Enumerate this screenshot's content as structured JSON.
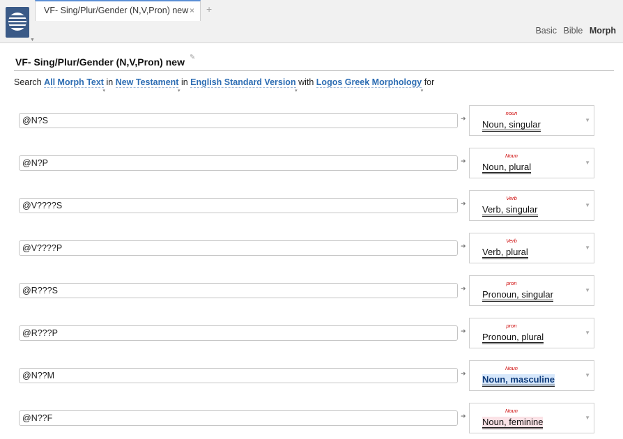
{
  "tab": {
    "title": "VF- Sing/Plur/Gender (N,V,Pron) new",
    "close": "×",
    "add": "+"
  },
  "modes": [
    {
      "label": "Basic",
      "active": false
    },
    {
      "label": "Bible",
      "active": false
    },
    {
      "label": "Morph",
      "active": true
    }
  ],
  "document": {
    "title": "VF- Sing/Plur/Gender (N,V,Pron) new"
  },
  "search": {
    "prefix": "Search",
    "scope": "All Morph Text",
    "in1": "in",
    "range": "New Testament",
    "in2": "in",
    "version": "English Standard Version",
    "with": "with",
    "morphology": "Logos Greek Morphology",
    "suffix": "for"
  },
  "rows": [
    {
      "query": "@N?S",
      "tag": "noun",
      "label": "Noun, singular",
      "highlight": ""
    },
    {
      "query": "@N?P",
      "tag": "Noun",
      "label": "Noun, plural",
      "highlight": ""
    },
    {
      "query": "@V????S",
      "tag": "Verb",
      "label": "Verb, singular",
      "highlight": ""
    },
    {
      "query": "@V????P",
      "tag": "Verb",
      "label": "Verb, plural",
      "highlight": ""
    },
    {
      "query": "@R???S",
      "tag": "pron",
      "label": "Pronoun, singular",
      "highlight": ""
    },
    {
      "query": "@R???P",
      "tag": "pron",
      "label": "Pronoun, plural",
      "highlight": ""
    },
    {
      "query": "@N??M",
      "tag": "Noun",
      "label": "Noun, masculine",
      "highlight": "blue"
    },
    {
      "query": "@N??F",
      "tag": "Noun",
      "label": "Noun, feminine",
      "highlight": "red"
    }
  ],
  "colors": {
    "accent": "#2d6db3",
    "tag": "#cc0000",
    "logo": "#3a5a87"
  }
}
